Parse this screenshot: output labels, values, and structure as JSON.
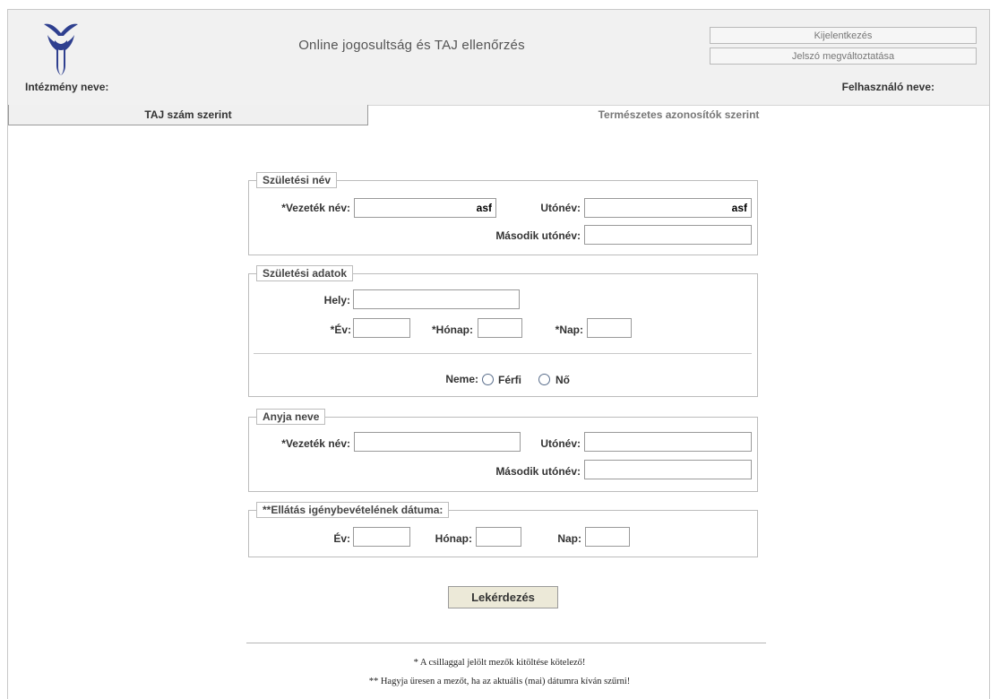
{
  "header": {
    "app_title": "Online jogosultság és TAJ ellenőrzés",
    "logout_label": "Kijelentkezés",
    "change_password_label": "Jelszó megváltoztatása",
    "institution_label": "Intézmény neve:",
    "user_label": "Felhasználó neve:",
    "logo_icon": "organization-logo-icon",
    "logo_color": "#2e3f8f"
  },
  "tabs": [
    {
      "label": "TAJ szám szerint",
      "active": true
    },
    {
      "label": "Természetes azonosítók szerint",
      "active": false
    }
  ],
  "birth_name": {
    "legend": "Születési név",
    "surname_label": "*Vezeték név:",
    "surname_value": "asf",
    "given_label": "Utónév:",
    "given_value": "asf",
    "second_given_label": "Második utónév:",
    "second_given_value": ""
  },
  "birth_data": {
    "legend": "Születési adatok",
    "place_label": "Hely:",
    "year_label": "*Év:",
    "month_label": "*Hónap:",
    "day_label": "*Nap:",
    "sex_label": "Neme:",
    "male_label": "Férfi",
    "female_label": "Nő"
  },
  "mother_name": {
    "legend": "Anyja neve",
    "surname_label": "*Vezeték név:",
    "given_label": "Utónév:",
    "second_given_label": "Második utónév:"
  },
  "service_date": {
    "legend": "**Ellátás igénybevételének dátuma:",
    "year_label": "Év:",
    "month_label": "Hónap:",
    "day_label": "Nap:"
  },
  "submit_label": "Lekérdezés",
  "footnotes": {
    "required": "* A csillaggal jelölt mezők kitöltése kötelező!",
    "date_hint": "** Hagyja üresen a mezőt, ha az aktuális (mai) dátumra kíván szűrni!"
  }
}
